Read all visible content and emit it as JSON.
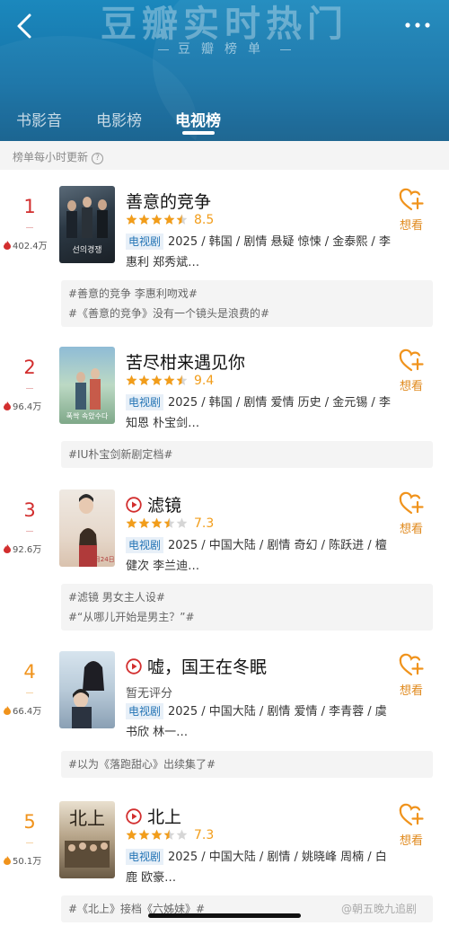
{
  "header": {
    "big_title": "豆瓣实时热门",
    "sub_title": "豆瓣榜单",
    "back_icon": "chevron-left-icon",
    "more_icon": "more-dots-icon"
  },
  "tabs": [
    {
      "label": "书影音",
      "active": false
    },
    {
      "label": "电影榜",
      "active": false
    },
    {
      "label": "电视榜",
      "active": true
    }
  ],
  "update_note": "榜单每小时更新",
  "items": [
    {
      "rank": "1",
      "heat": "402.4万",
      "title": "善意的竞争",
      "has_play": false,
      "rating_score": "8.5",
      "stars": 4.5,
      "no_rating": "",
      "tag": "电视剧",
      "desc_line1": "2025 / 韩国 / 剧情 悬疑 惊悚 / 金泰熙 / 李",
      "desc_line2": "惠利 郑秀斌…",
      "want_label": "想看",
      "topics": [
        "#善意的竞争 李惠利吻戏#",
        "#《善意的竞争》没有一个镜头是浪费的#"
      ]
    },
    {
      "rank": "2",
      "heat": "96.4万",
      "title": "苦尽柑来遇见你",
      "has_play": false,
      "rating_score": "9.4",
      "stars": 4.5,
      "no_rating": "",
      "tag": "电视剧",
      "desc_line1": "2025 / 韩国 / 剧情 爱情 历史 / 金元锡 / 李",
      "desc_line2": "知恩 朴宝剑…",
      "want_label": "想看",
      "topics": [
        "#IU朴宝剑新剧定档#"
      ]
    },
    {
      "rank": "3",
      "heat": "92.6万",
      "title": "滤镜",
      "has_play": true,
      "rating_score": "7.3",
      "stars": 3.5,
      "no_rating": "",
      "tag": "电视剧",
      "desc_line1": "2025 / 中国大陆 / 剧情 奇幻 / 陈跃进 / 檀",
      "desc_line2": "健次 李兰迪…",
      "want_label": "想看",
      "topics": [
        "#滤镜 男女主人设#",
        "#“从哪儿开始是男主？”#"
      ]
    },
    {
      "rank": "4",
      "heat": "66.4万",
      "title": "嘘，国王在冬眠",
      "has_play": true,
      "rating_score": "",
      "stars": 0,
      "no_rating": "暂无评分",
      "tag": "电视剧",
      "desc_line1": "2025 / 中国大陆 / 剧情 爱情 / 李青蓉 / 虞",
      "desc_line2": "书欣 林一…",
      "want_label": "想看",
      "topics": [
        "#以为《落跑甜心》出续集了#"
      ]
    },
    {
      "rank": "5",
      "heat": "50.1万",
      "title": "北上",
      "has_play": true,
      "rating_score": "7.3",
      "stars": 3.5,
      "no_rating": "",
      "tag": "电视剧",
      "desc_line1": "2025 / 中国大陆 / 剧情 / 姚晓峰 周楠 / 白",
      "desc_line2": "鹿 欧豪…",
      "want_label": "想看",
      "topics": [
        "#《北上》接档《六姊妹》#"
      ]
    }
  ],
  "watermark": "@朝五晚九追剧",
  "colors": {
    "header_blue": "#1672a6",
    "rank_red": "#d22e2e",
    "rank_orange": "#f0931c",
    "rating_orange": "#f29d1a",
    "tag_blue": "#2474b5"
  }
}
